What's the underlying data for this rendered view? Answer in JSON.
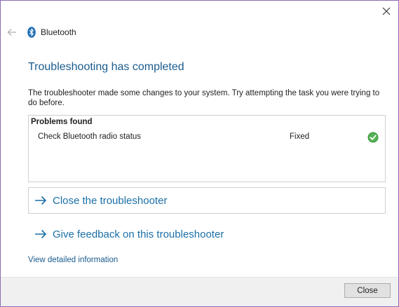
{
  "window": {
    "app_title": "Bluetooth",
    "close_icon": "close-icon",
    "back_icon": "back-arrow-icon",
    "app_icon": "bluetooth-icon"
  },
  "main": {
    "heading": "Troubleshooting has completed",
    "description": "The troubleshooter made some changes to your system. Try attempting the task you were trying to do before.",
    "problems": {
      "header": "Problems found",
      "items": [
        {
          "name": "Check Bluetooth radio status",
          "status": "Fixed",
          "status_icon": "check-circle-icon"
        }
      ]
    },
    "actions": [
      {
        "label": "Close the troubleshooter",
        "icon": "arrow-right-icon"
      },
      {
        "label": "Give feedback on this troubleshooter",
        "icon": "arrow-right-icon"
      }
    ],
    "detail_link": "View detailed information"
  },
  "footer": {
    "close_label": "Close"
  },
  "colors": {
    "heading": "#1b5c8f",
    "link": "#1b6fa8",
    "success": "#3a9a3a",
    "window_border": "#8a6bb5",
    "footer_bg": "#f0f0f0"
  }
}
